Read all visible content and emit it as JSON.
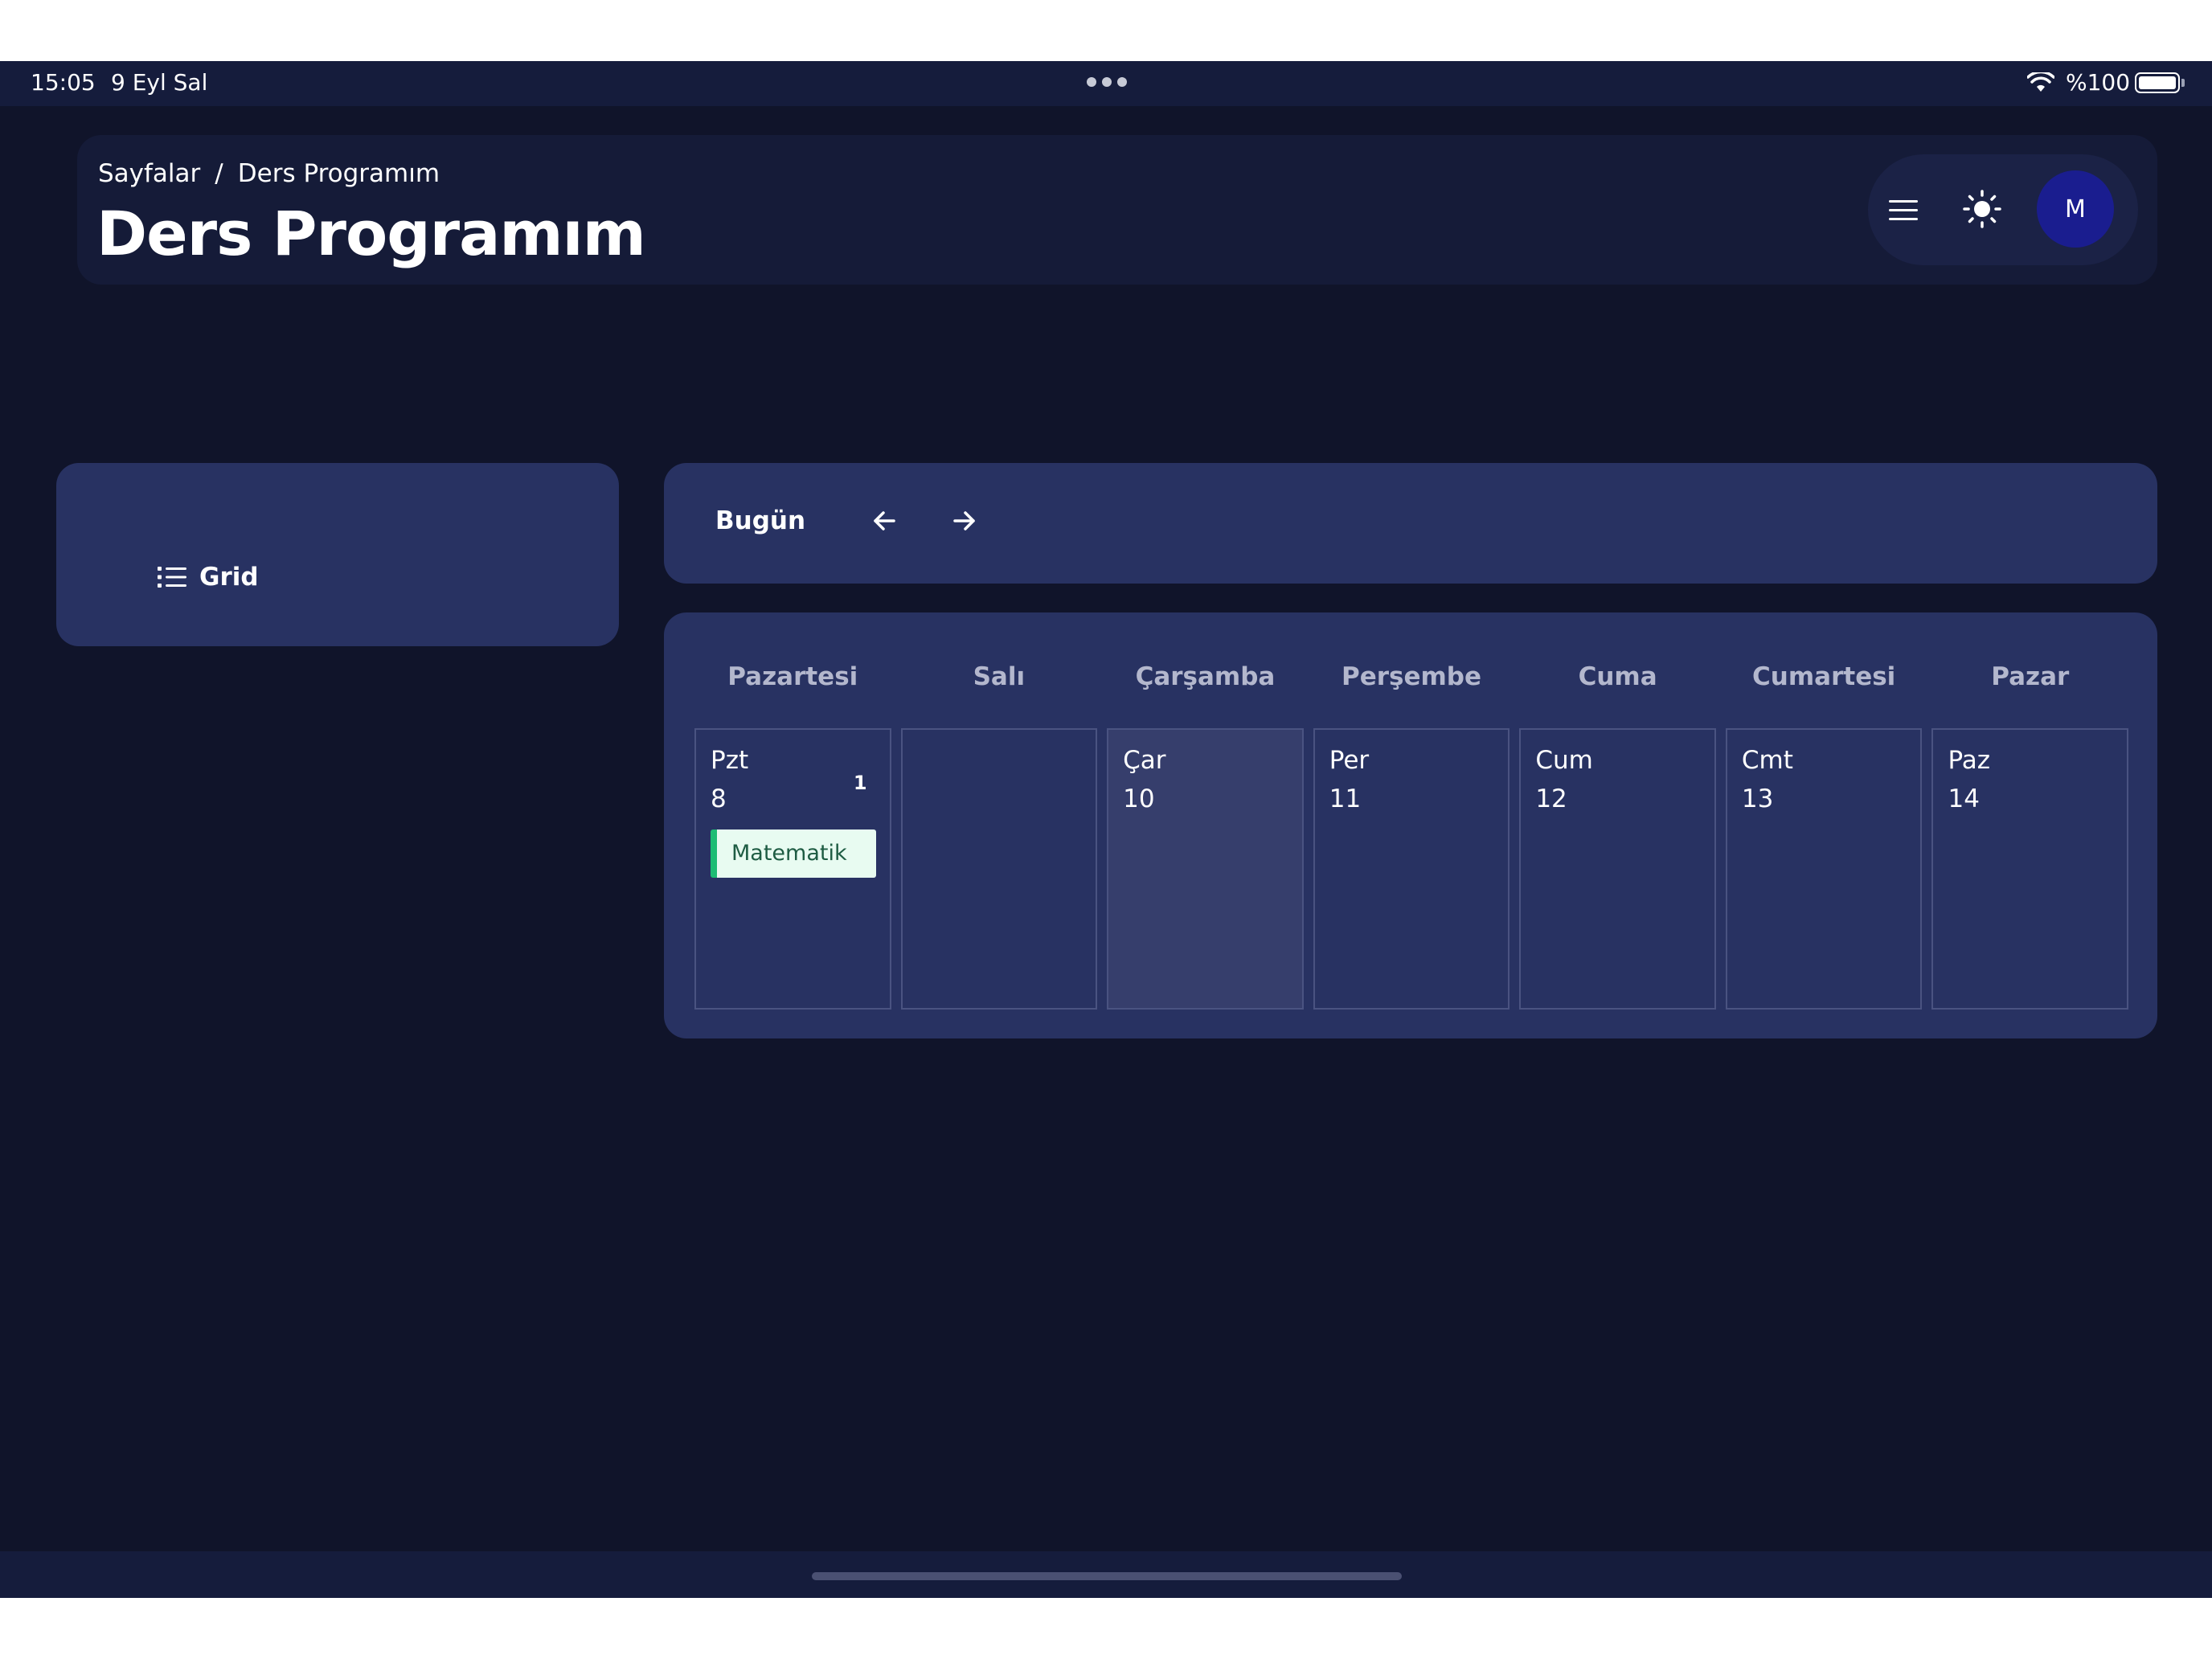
{
  "status_bar": {
    "time": "15:05",
    "date": "9 Eyl Sal",
    "battery_percent": "%100",
    "battery_level": 1.0
  },
  "header": {
    "breadcrumb": {
      "root": "Sayfalar",
      "separator": "/",
      "current": "Ders Programım"
    },
    "title": "Ders Programım",
    "actions": {
      "menu_icon": "hamburger-menu-icon",
      "theme_icon": "sun-icon",
      "avatar_initial": "M"
    }
  },
  "view_selector": {
    "icon": "list-icon",
    "label": "Grid"
  },
  "toolbar": {
    "today_label": "Bugün",
    "prev_icon": "arrow-left-icon",
    "next_icon": "arrow-right-icon"
  },
  "calendar": {
    "weekdays": [
      "Pazartesi",
      "Salı",
      "Çarşamba",
      "Perşembe",
      "Cuma",
      "Cumartesi",
      "Pazar"
    ],
    "days": [
      {
        "abbr": "Pzt",
        "number": "8",
        "count": "1",
        "events": [
          "Matematik"
        ],
        "today": false
      },
      {
        "abbr": "",
        "number": "",
        "count": "",
        "events": [],
        "today": false
      },
      {
        "abbr": "Çar",
        "number": "10",
        "count": "",
        "events": [],
        "today": true
      },
      {
        "abbr": "Per",
        "number": "11",
        "count": "",
        "events": [],
        "today": false
      },
      {
        "abbr": "Cum",
        "number": "12",
        "count": "",
        "events": [],
        "today": false
      },
      {
        "abbr": "Cmt",
        "number": "13",
        "count": "",
        "events": [],
        "today": false
      },
      {
        "abbr": "Paz",
        "number": "14",
        "count": "",
        "events": [],
        "today": false
      }
    ]
  },
  "colors": {
    "background": "#10142a",
    "card": "#283262",
    "header_card": "#151b38",
    "avatar": "#1a1d8f",
    "event_bg": "#e8fbf1",
    "event_accent": "#1dbc74",
    "today_cell": "#363e6c"
  }
}
